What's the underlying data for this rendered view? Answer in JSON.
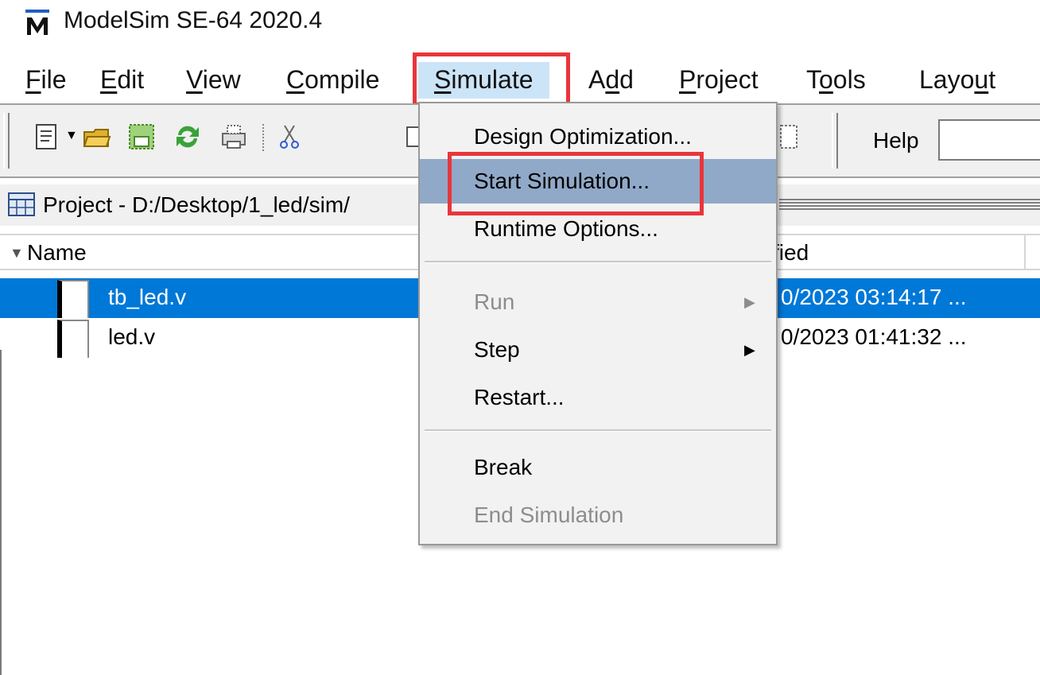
{
  "window": {
    "title": "ModelSim SE-64 2020.4",
    "logo_icon": "modelsim-logo"
  },
  "menubar": {
    "items": [
      {
        "label": "File",
        "u": "F",
        "rest": "ile"
      },
      {
        "label": "Edit",
        "u": "E",
        "rest": "dit"
      },
      {
        "label": "View",
        "u": "V",
        "rest": "iew"
      },
      {
        "label": "Compile",
        "u": "C",
        "rest": "ompile"
      },
      {
        "label": "Simulate",
        "u": "S",
        "rest": "imulate"
      },
      {
        "label": "Add",
        "pre": "A",
        "u": "d",
        "rest": "d"
      },
      {
        "label": "Project",
        "u": "P",
        "rest": "roject"
      },
      {
        "label": "Tools",
        "pre": "T",
        "u": "o",
        "rest": "ols"
      },
      {
        "label": "Layout",
        "pre": "Layo",
        "u": "u",
        "rest": "t"
      }
    ],
    "active": "Simulate"
  },
  "toolbar": {
    "icons": [
      "new-file-icon",
      "open-folder-icon",
      "save-icon",
      "reload-icon",
      "print-icon",
      "cut-icon",
      "copy-icon",
      "compile-icon"
    ],
    "help_label": "Help",
    "help_value": ""
  },
  "project_panel": {
    "title": "Project - D:/Desktop/1_led/sim/",
    "columns": {
      "name": "Name",
      "modified": "fied"
    },
    "files": [
      {
        "name": "tb_led.v",
        "modified": "0/2023 03:14:17 ...",
        "selected": true
      },
      {
        "name": "led.v",
        "modified": "0/2023 01:41:32 ...",
        "selected": false
      }
    ]
  },
  "simulate_menu": {
    "items": [
      {
        "label": "Design Optimization...",
        "enabled": true
      },
      {
        "label": "Start Simulation...",
        "enabled": true,
        "highlighted": true
      },
      {
        "label": "Runtime Options...",
        "enabled": true
      },
      {
        "label": "Run",
        "enabled": false,
        "submenu": true
      },
      {
        "label": "Step",
        "enabled": true,
        "submenu": true
      },
      {
        "label": "Restart...",
        "enabled": true
      },
      {
        "label": "Break",
        "enabled": true
      },
      {
        "label": "End Simulation",
        "enabled": false
      }
    ]
  },
  "colors": {
    "highlight_box": "#e8363b",
    "selection": "#0078d7",
    "menu_hover": "#91a9c8"
  }
}
